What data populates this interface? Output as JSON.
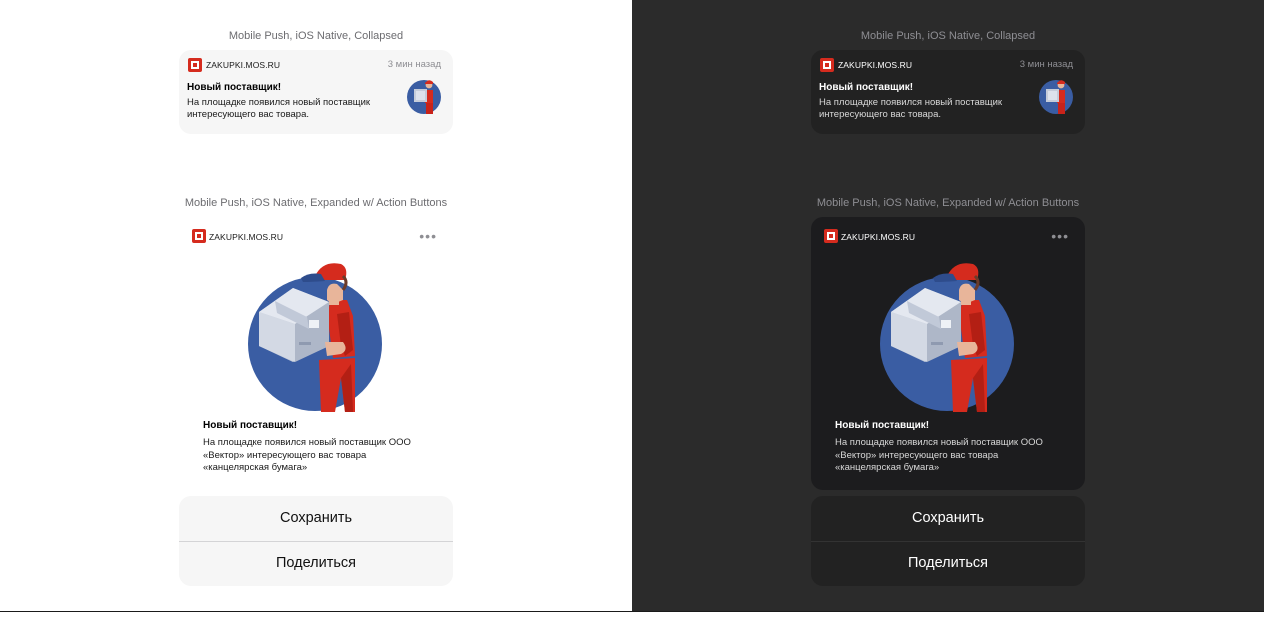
{
  "captions": {
    "collapsed": "Mobile Push, iOS Native, Collapsed",
    "expanded": "Mobile Push, iOS Native, Expanded w/ Action Buttons"
  },
  "app": {
    "name": "ZAKUPKI.MOS.RU",
    "icon": "zakupki-logo-icon",
    "brand_color": "#d52b1e"
  },
  "collapsed": {
    "time": "3 мин назад",
    "title": "Новый поставщик!",
    "body": "На площадке появился новый поставщик интересующего вас товара."
  },
  "expanded": {
    "more": "•••",
    "title": "Новый поставщик!",
    "body": "На площадке появился новый поставщик ООО «Вектор» интересующего вас товара «канцелярская бумага»"
  },
  "actions": {
    "save": "Сохранить",
    "share": "Поделиться"
  },
  "themes": {
    "light_background": "#ffffff",
    "dark_background": "#2b2b2b",
    "dark_card": "#1c1c1e",
    "illustration_circle": "#3a5da3",
    "illustration_uniform": "#d52b1e"
  }
}
